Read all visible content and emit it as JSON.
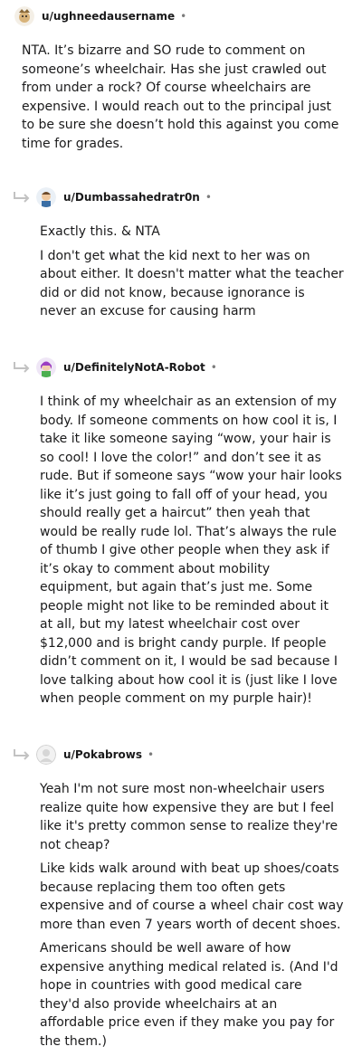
{
  "comments": [
    {
      "username": "u/ughneedausername",
      "dot": "•",
      "avatar": "avatar-icon",
      "paragraphs": [
        "NTA. It’s bizarre and SO rude to comment on someone’s wheelchair. Has she just crawled out from under a rock? Of course wheelchairs are expensive. I would reach out to the principal just to be sure she doesn’t hold this against you come time for grades."
      ]
    },
    {
      "username": "u/Dumbassahedratr0n",
      "dot": "•",
      "avatar": "avatar-icon",
      "paragraphs": [
        "Exactly this. & NTA",
        "I don't get what the kid next to her was on about either. It doesn't matter what the teacher did or did not know, because ignorance is never an excuse for causing harm"
      ]
    },
    {
      "username": "u/DefinitelyNotA-Robot",
      "dot": "•",
      "avatar": "avatar-icon",
      "paragraphs": [
        "I think of my wheelchair as an extension of my body. If someone comments on how cool it is, I take it like someone saying “wow, your hair is so cool! I love the color!” and don’t see it as rude. But if someone says “wow your hair looks like it’s just going to fall off of your head, you should really get a haircut” then yeah that would be really rude lol. That’s always the rule of thumb I give other people when they ask if it’s okay to comment about mobility equipment, but again that’s just me. Some people might not like to be reminded about it at all, but my latest wheelchair cost over $12,000 and is bright candy purple. If people didn’t comment on it, I would be sad because I love talking about how cool it is (just like I love when people comment on my purple hair)!"
      ]
    },
    {
      "username": "u/Pokabrows",
      "dot": "•",
      "avatar": "avatar-icon",
      "paragraphs": [
        "Yeah I'm not sure most non-wheelchair users realize quite how expensive they are but I feel like it's pretty common sense to realize they're not cheap?",
        "Like kids walk around with beat up shoes/coats because replacing them too often gets expensive and of course a wheel chair cost way more than even 7 years worth of decent shoes.",
        "Americans should be well aware of how expensive anything medical related is. (And I'd hope in countries with good medical care they'd also provide wheelchairs at an affordable price even if they make you pay for the them.)"
      ]
    }
  ]
}
